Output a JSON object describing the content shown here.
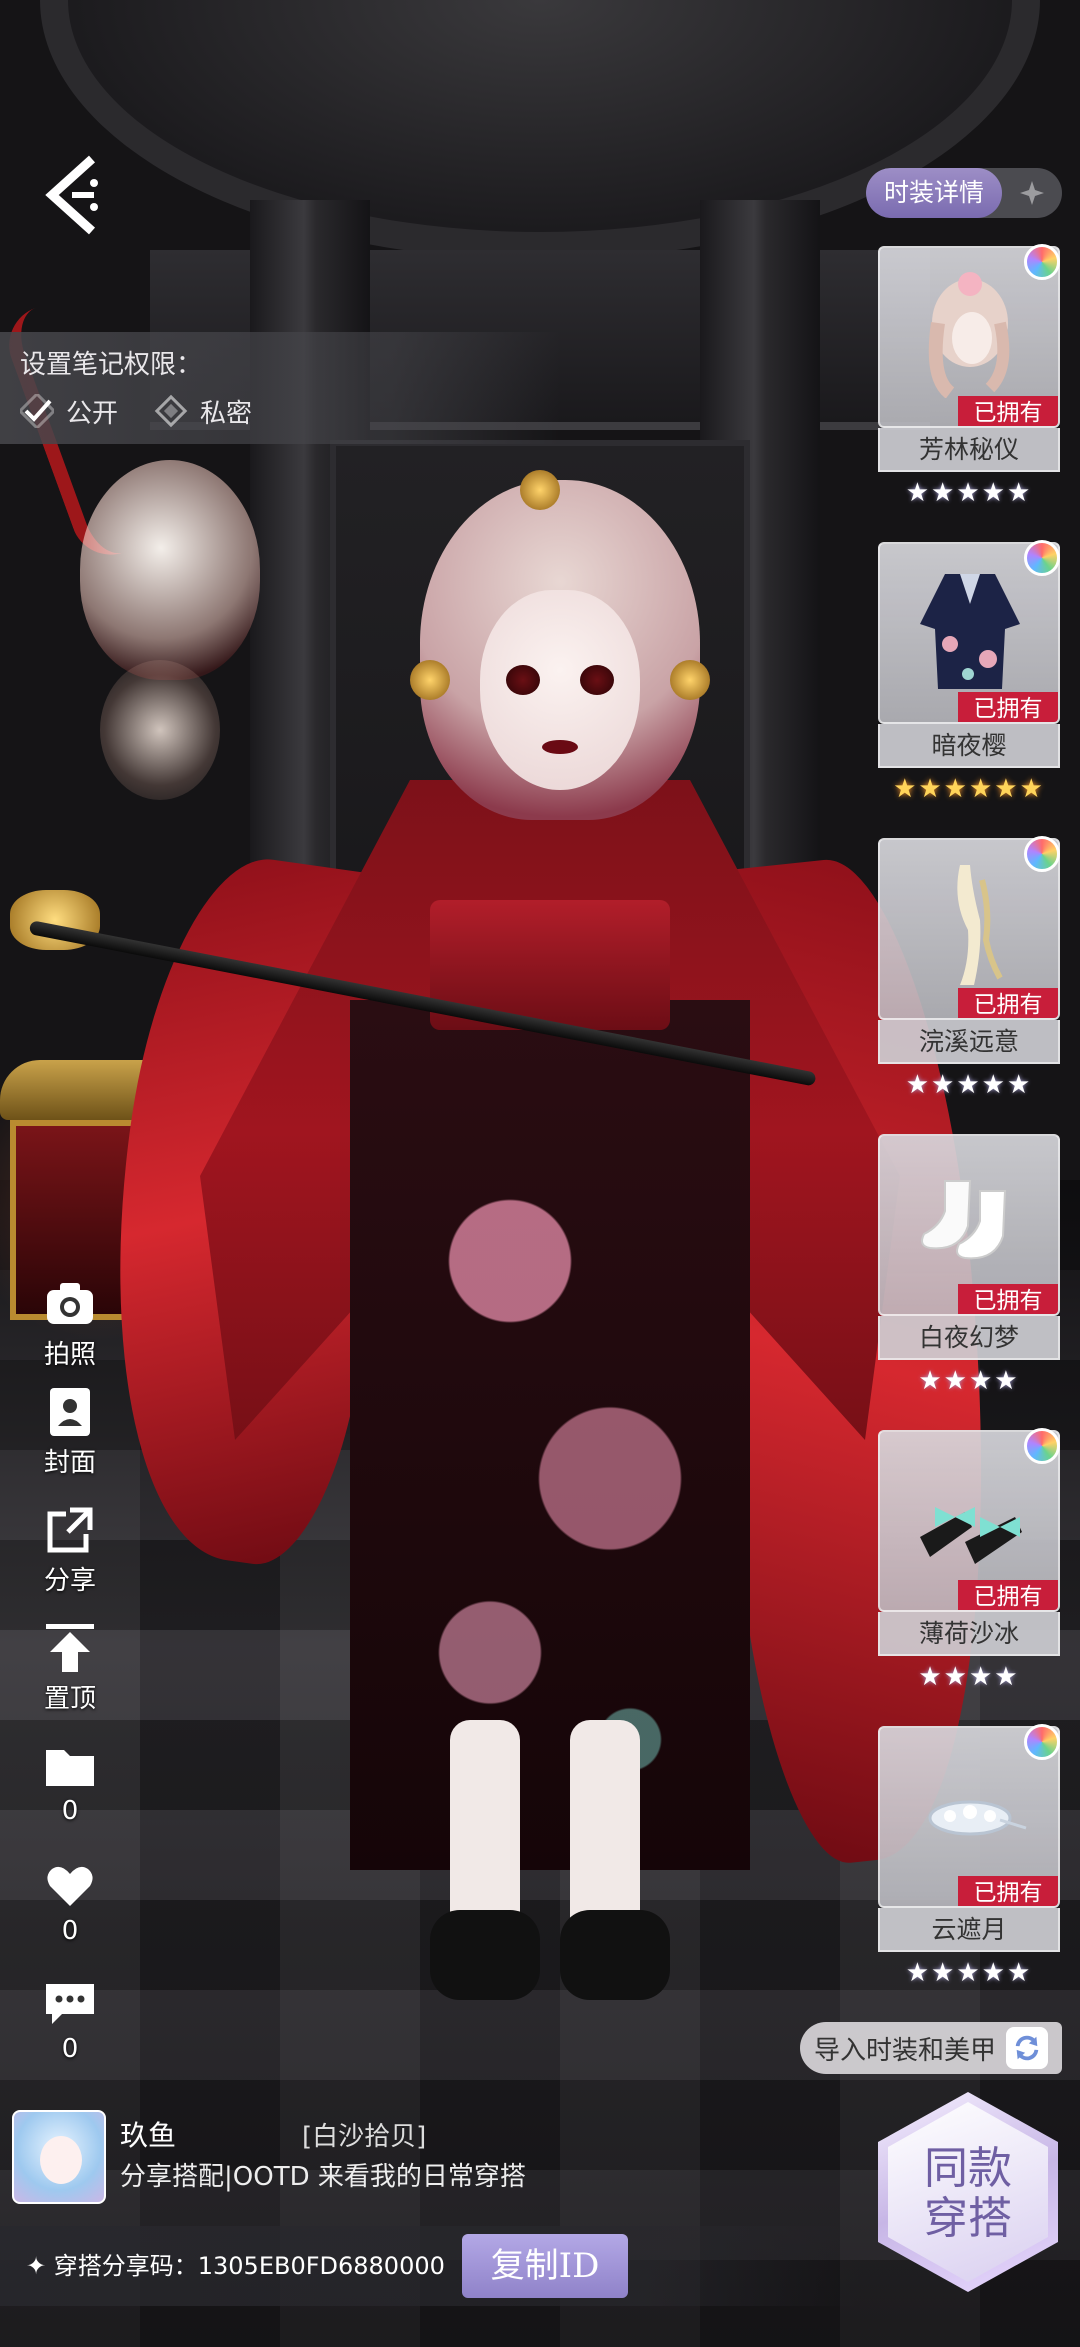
{
  "privacy": {
    "title": "设置笔记权限：",
    "options": [
      {
        "label": "公开",
        "selected": true
      },
      {
        "label": "私密",
        "selected": false
      }
    ]
  },
  "tabs": {
    "active": "时装详情"
  },
  "items": [
    {
      "name": "芳林秘仪",
      "status": "已拥有",
      "stars": "★★★★★",
      "rarity": "silver"
    },
    {
      "name": "暗夜樱",
      "status": "已拥有",
      "stars": "★★★★★★",
      "rarity": "gold"
    },
    {
      "name": "浣溪远意",
      "status": "已拥有",
      "stars": "★★★★★",
      "rarity": "silver"
    },
    {
      "name": "白夜幻梦",
      "status": "已拥有",
      "stars": "★★★★",
      "rarity": "silver"
    },
    {
      "name": "薄荷沙冰",
      "status": "已拥有",
      "stars": "★★★★",
      "rarity": "silver"
    },
    {
      "name": "云遮月",
      "status": "已拥有",
      "stars": "★★★★★",
      "rarity": "silver"
    }
  ],
  "import_label": "导入时装和美甲",
  "same_outfit": {
    "line1": "同款",
    "line2": "穿搭"
  },
  "side_actions": {
    "photo": "拍照",
    "cover": "封面",
    "share": "分享",
    "pin": "置顶",
    "collect_count": "0",
    "like_count": "0",
    "comment_count": "0"
  },
  "profile": {
    "username": "玖鱼",
    "tag": "[白沙拾贝]",
    "description": "分享搭配|OOTD 来看我的日常穿搭"
  },
  "share": {
    "code_label": "✦ 穿搭分享码：1305EB0FD6880000",
    "copy_button": "复制ID"
  },
  "colors": {
    "accent": "#8f82c9",
    "owned_badge": "#c81e3a",
    "star_gold": "#ffd45a"
  }
}
